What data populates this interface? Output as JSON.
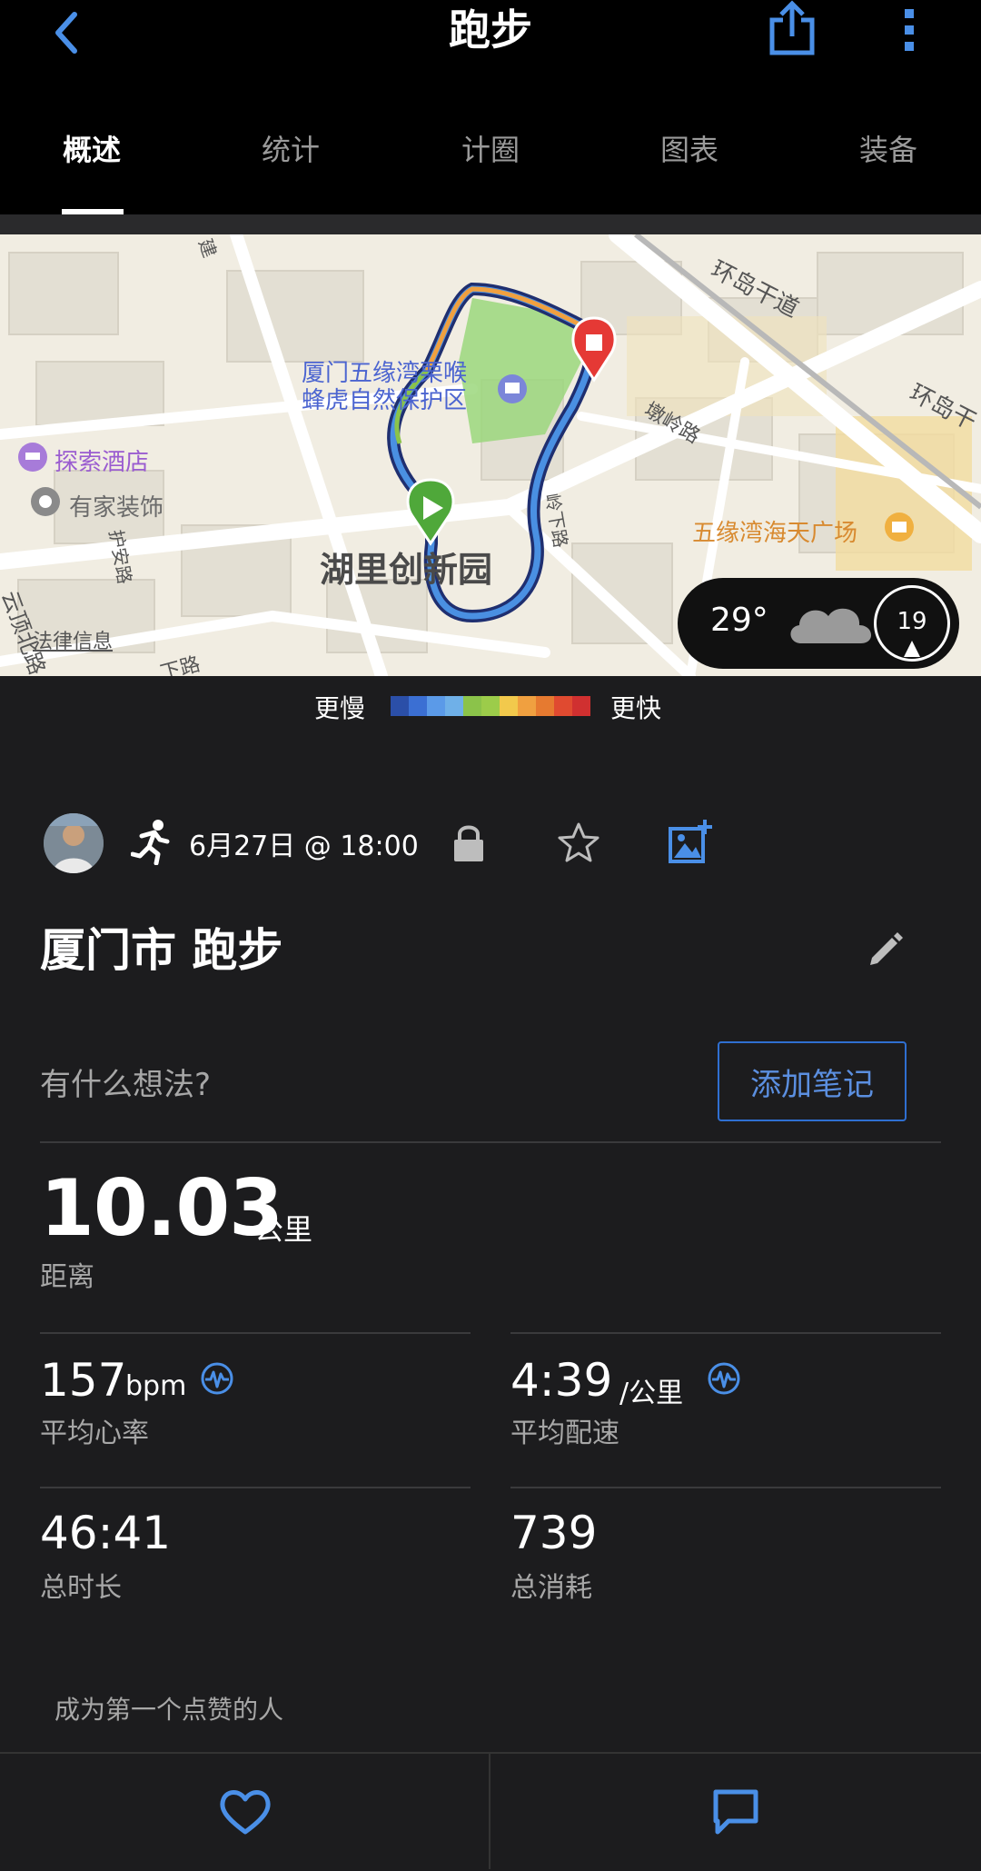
{
  "header": {
    "title": "跑步",
    "tabs": [
      {
        "label": "概述",
        "active": true
      },
      {
        "label": "统计",
        "active": false
      },
      {
        "label": "计圈",
        "active": false
      },
      {
        "label": "图表",
        "active": false
      },
      {
        "label": "装备",
        "active": false
      }
    ],
    "icons": {
      "back": "chevron-left-icon",
      "share": "share-icon",
      "more": "more-vertical-icon"
    }
  },
  "map": {
    "labels": {
      "reserve_line1": "厦门五缘湾栗喉",
      "reserve_line2": "蜂虎自然保护区",
      "hotel": "探索酒店",
      "decor": "有家装饰",
      "park": "湖里创新园",
      "plaza": "五缘湾海天广场",
      "road_huandao": "环岛干道",
      "road_huandao2": "环岛干",
      "road_dunling": "墩岭路",
      "road_huan": "护安路",
      "road_yunding": "云顶北路",
      "road_lingxia": "岭下路",
      "legal": "法律信息",
      "road_jian": "建",
      "road_xia": "下路"
    },
    "weather": {
      "temperature": "29°",
      "wind": "19",
      "icon": "cloud-icon"
    }
  },
  "legend": {
    "slower": "更慢",
    "faster": "更快",
    "colors": [
      "#2b4fa8",
      "#3b6fd3",
      "#5b9ae8",
      "#6fb0e8",
      "#8bc34a",
      "#9ccc4a",
      "#f2c94c",
      "#f0a040",
      "#e67a30",
      "#e04a30",
      "#d03030"
    ]
  },
  "activity": {
    "datetime": "6月27日 @ 18:00",
    "title": "厦门市 跑步",
    "notes_prompt": "有什么想法?",
    "add_note": "添加笔记"
  },
  "stats": {
    "distance": {
      "value": "10.03",
      "unit": "公里",
      "label": "距离"
    },
    "heart_rate": {
      "value": "157",
      "unit": "bpm",
      "label": "平均心率"
    },
    "pace": {
      "value": "4:39",
      "unit": "/公里",
      "label": "平均配速"
    },
    "duration": {
      "value": "46:41",
      "label": "总时长"
    },
    "calories": {
      "value": "739",
      "label": "总消耗"
    }
  },
  "social": {
    "kudos": "成为第一个点赞的人"
  },
  "colors": {
    "accent": "#2f6fd1",
    "route_start": "#4fa83a",
    "route_end": "#e53935"
  }
}
